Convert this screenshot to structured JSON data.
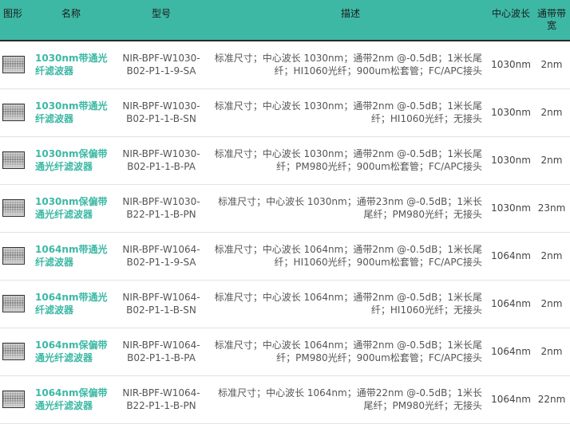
{
  "headers": {
    "image": "图形",
    "name": "名称",
    "model": "型号",
    "description": "描述",
    "center_wavelength": "中心波长",
    "bandwidth": "通带带宽"
  },
  "rows": [
    {
      "name": "1030nm带通光纤滤波器",
      "model": "NIR-BPF-W1030-B02-P1-1-9-SA",
      "description": "标准尺寸；中心波长 1030nm；通带2nm @-0.5dB；1米长尾纤；HI1060光纤；900um松套管；FC/APC接头",
      "wavelength": "1030nm",
      "bandwidth": "2nm"
    },
    {
      "name": "1030nm带通光纤滤波器",
      "model": "NIR-BPF-W1030-B02-P1-1-B-SN",
      "description": "标准尺寸；中心波长 1030nm；通带2nm @-0.5dB；1米长尾纤；HI1060光纤；无接头",
      "wavelength": "1030nm",
      "bandwidth": "2nm"
    },
    {
      "name": "1030nm保偏带通光纤滤波器",
      "model": "NIR-BPF-W1030-B02-P1-1-B-PA",
      "description": "标准尺寸；中心波长 1030nm；通带2nm @-0.5dB；1米长尾纤；PM980光纤；900um松套管；FC/APC接头",
      "wavelength": "1030nm",
      "bandwidth": "2nm"
    },
    {
      "name": "1030nm保偏带通光纤滤波器",
      "model": "NIR-BPF-W1030-B22-P1-1-B-PN",
      "description": "标准尺寸；中心波长 1030nm；通带23nm @-0.5dB；1米长尾纤；PM980光纤；无接头",
      "wavelength": "1030nm",
      "bandwidth": "23nm"
    },
    {
      "name": "1064nm带通光纤滤波器",
      "model": "NIR-BPF-W1064-B02-P1-1-9-SA",
      "description": "标准尺寸；中心波长 1064nm；通带2nm @-0.5dB；1米长尾纤；HI1060光纤；900um松套管；FC/APC接头",
      "wavelength": "1064nm",
      "bandwidth": "2nm"
    },
    {
      "name": "1064nm带通光纤滤波器",
      "model": "NIR-BPF-W1064-B02-P1-1-B-SN",
      "description": "标准尺寸；中心波长 1064nm；通带2nm @-0.5dB；1米长尾纤；HI1060光纤；无接头",
      "wavelength": "1064nm",
      "bandwidth": "2nm"
    },
    {
      "name": "1064nm保偏带通光纤滤波器",
      "model": "NIR-BPF-W1064-B02-P1-1-B-PA",
      "description": "标准尺寸；中心波长 1064nm；通带2nm @-0.5dB；1米长尾纤；PM980光纤；900um松套管；FC/APC接头",
      "wavelength": "1064nm",
      "bandwidth": "2nm"
    },
    {
      "name": "1064nm保偏带通光纤滤波器",
      "model": "NIR-BPF-W1064-B22-P1-1-B-PN",
      "description": "标准尺寸；中心波长 1064nm；通带22nm @-0.5dB；1米长尾纤；PM980光纤；无接头",
      "wavelength": "1064nm",
      "bandwidth": "22nm"
    }
  ],
  "colors": {
    "header_bg": "#3db8a5",
    "link": "#3db8a5"
  },
  "icons": {
    "row_image": "filter-thumbnail-icon"
  }
}
